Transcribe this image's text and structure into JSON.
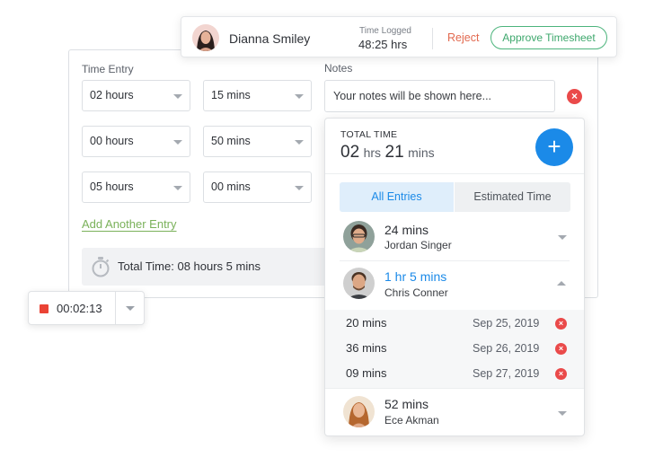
{
  "approval": {
    "user_name": "Dianna Smiley",
    "time_logged_label": "Time Logged",
    "time_logged_value": "48:25 hrs",
    "reject_label": "Reject",
    "approve_label": "Approve Timesheet"
  },
  "form": {
    "time_entry_label": "Time Entry",
    "notes_label": "Notes",
    "notes_placeholder": "Your notes will be shown here...",
    "rows": [
      {
        "hours": "02 hours",
        "mins": "15 mins"
      },
      {
        "hours": "00 hours",
        "mins": "50 mins"
      },
      {
        "hours": "05 hours",
        "mins": "00 mins"
      }
    ],
    "add_entry_label": "Add Another Entry",
    "total_label": "Total Time: 08 hours 5 mins"
  },
  "timer": {
    "value": "00:02:13"
  },
  "panel": {
    "title": "TOTAL TIME",
    "total_hours": "02",
    "hours_unit": "hrs",
    "total_mins": "21",
    "mins_unit": "mins",
    "add_symbol": "+",
    "tabs": [
      {
        "label": "All Entries",
        "active": true
      },
      {
        "label": "Estimated Time",
        "active": false
      }
    ],
    "entries": [
      {
        "time": "24 mins",
        "name": "Jordan Singer",
        "expanded": false
      },
      {
        "time": "1 hr 5 mins",
        "name": "Chris Conner",
        "expanded": true,
        "sub_entries": [
          {
            "mins": "20 mins",
            "date": "Sep 25, 2019"
          },
          {
            "mins": "36 mins",
            "date": "Sep 26, 2019"
          },
          {
            "mins": "09 mins",
            "date": "Sep 27, 2019"
          }
        ]
      },
      {
        "time": "52 mins",
        "name": "Ece Akman",
        "expanded": false
      }
    ]
  },
  "colors": {
    "accent_blue": "#1b8ae8",
    "approve_green": "#3ea86d",
    "reject_orange": "#e2694f",
    "link_green": "#7ab15a",
    "danger_red": "#ea4a4a"
  }
}
